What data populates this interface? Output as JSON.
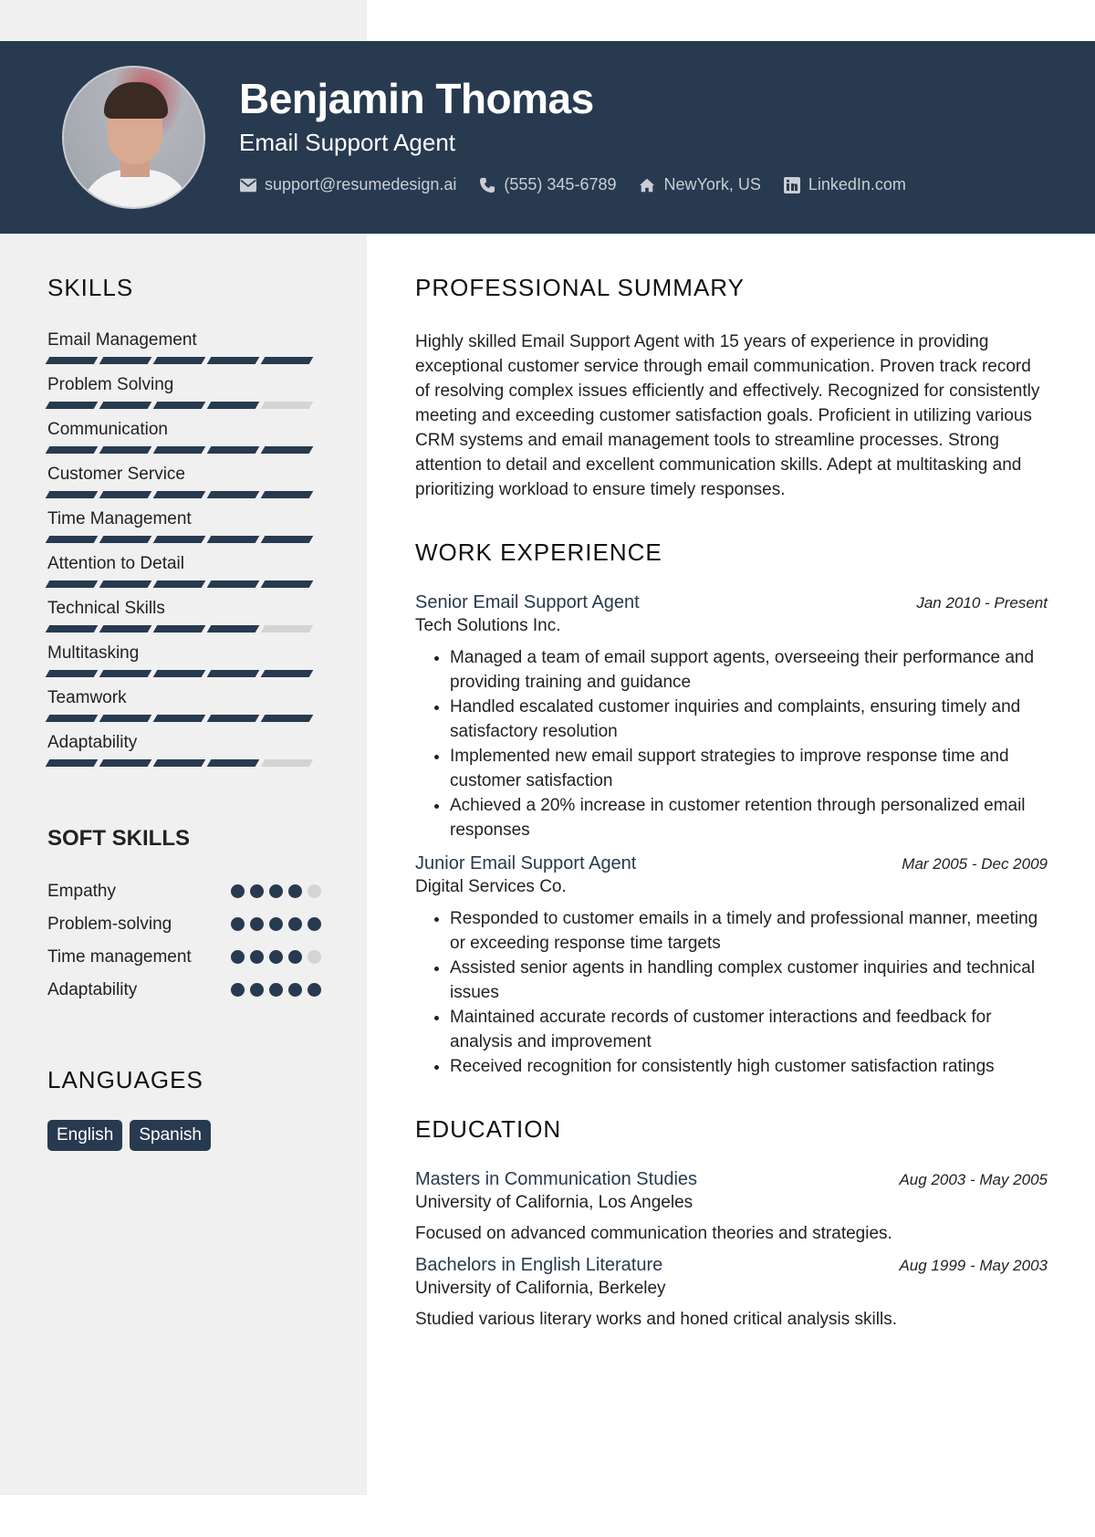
{
  "header": {
    "name": "Benjamin Thomas",
    "role": "Email Support Agent",
    "contacts": [
      {
        "icon": "envelope-icon",
        "text": "support@resumedesign.ai"
      },
      {
        "icon": "phone-icon",
        "text": "(555) 345-6789"
      },
      {
        "icon": "home-icon",
        "text": "NewYork, US"
      },
      {
        "icon": "linkedin-icon",
        "text": "LinkedIn.com"
      }
    ]
  },
  "colors": {
    "accent": "#283a4f",
    "sidebar": "#f0f0f0",
    "inactive": "#d4d4d4"
  },
  "sidebar": {
    "skills_title": "SKILLS",
    "skills": [
      {
        "name": "Email Management",
        "level": 5,
        "max": 5
      },
      {
        "name": "Problem Solving",
        "level": 4,
        "max": 5
      },
      {
        "name": "Communication",
        "level": 5,
        "max": 5
      },
      {
        "name": "Customer Service",
        "level": 5,
        "max": 5
      },
      {
        "name": "Time Management",
        "level": 5,
        "max": 5
      },
      {
        "name": "Attention to Detail",
        "level": 5,
        "max": 5
      },
      {
        "name": "Technical Skills",
        "level": 4,
        "max": 5
      },
      {
        "name": "Multitasking",
        "level": 5,
        "max": 5
      },
      {
        "name": "Teamwork",
        "level": 5,
        "max": 5
      },
      {
        "name": "Adaptability",
        "level": 4,
        "max": 5
      }
    ],
    "soft_title": "SOFT SKILLS",
    "soft_skills": [
      {
        "name": "Empathy",
        "level": 4,
        "max": 5
      },
      {
        "name": "Problem-solving",
        "level": 5,
        "max": 5
      },
      {
        "name": "Time management",
        "level": 4,
        "max": 5
      },
      {
        "name": "Adaptability",
        "level": 5,
        "max": 5
      }
    ],
    "languages_title": "LANGUAGES",
    "languages": [
      "English",
      "Spanish"
    ]
  },
  "main": {
    "summary_title": "PROFESSIONAL SUMMARY",
    "summary": "Highly skilled Email Support Agent with 15 years of experience in providing exceptional customer service through email communication. Proven track record of resolving complex issues efficiently and effectively. Recognized for consistently meeting and exceeding customer satisfaction goals. Proficient in utilizing various CRM systems and email management tools to streamline processes. Strong attention to detail and excellent communication skills. Adept at multitasking and prioritizing workload to ensure timely responses.",
    "experience_title": "WORK EXPERIENCE",
    "experience": [
      {
        "title": "Senior Email Support Agent",
        "date": "Jan 2010 - Present",
        "company": "Tech Solutions Inc.",
        "bullets": [
          "Managed a team of email support agents, overseeing their performance and providing training and guidance",
          "Handled escalated customer inquiries and complaints, ensuring timely and satisfactory resolution",
          "Implemented new email support strategies to improve response time and customer satisfaction",
          "Achieved a 20% increase in customer retention through personalized email responses"
        ]
      },
      {
        "title": "Junior Email Support Agent",
        "date": "Mar 2005 - Dec 2009",
        "company": "Digital Services Co.",
        "bullets": [
          "Responded to customer emails in a timely and professional manner, meeting or exceeding response time targets",
          "Assisted senior agents in handling complex customer inquiries and technical issues",
          "Maintained accurate records of customer interactions and feedback for analysis and improvement",
          "Received recognition for consistently high customer satisfaction ratings"
        ]
      }
    ],
    "education_title": "EDUCATION",
    "education": [
      {
        "degree": "Masters in Communication Studies",
        "date": "Aug 2003 - May 2005",
        "school": "University of California, Los Angeles",
        "description": "Focused on advanced communication theories and strategies."
      },
      {
        "degree": "Bachelors in English Literature",
        "date": "Aug 1999 - May 2003",
        "school": "University of California, Berkeley",
        "description": "Studied various literary works and honed critical analysis skills."
      }
    ]
  }
}
